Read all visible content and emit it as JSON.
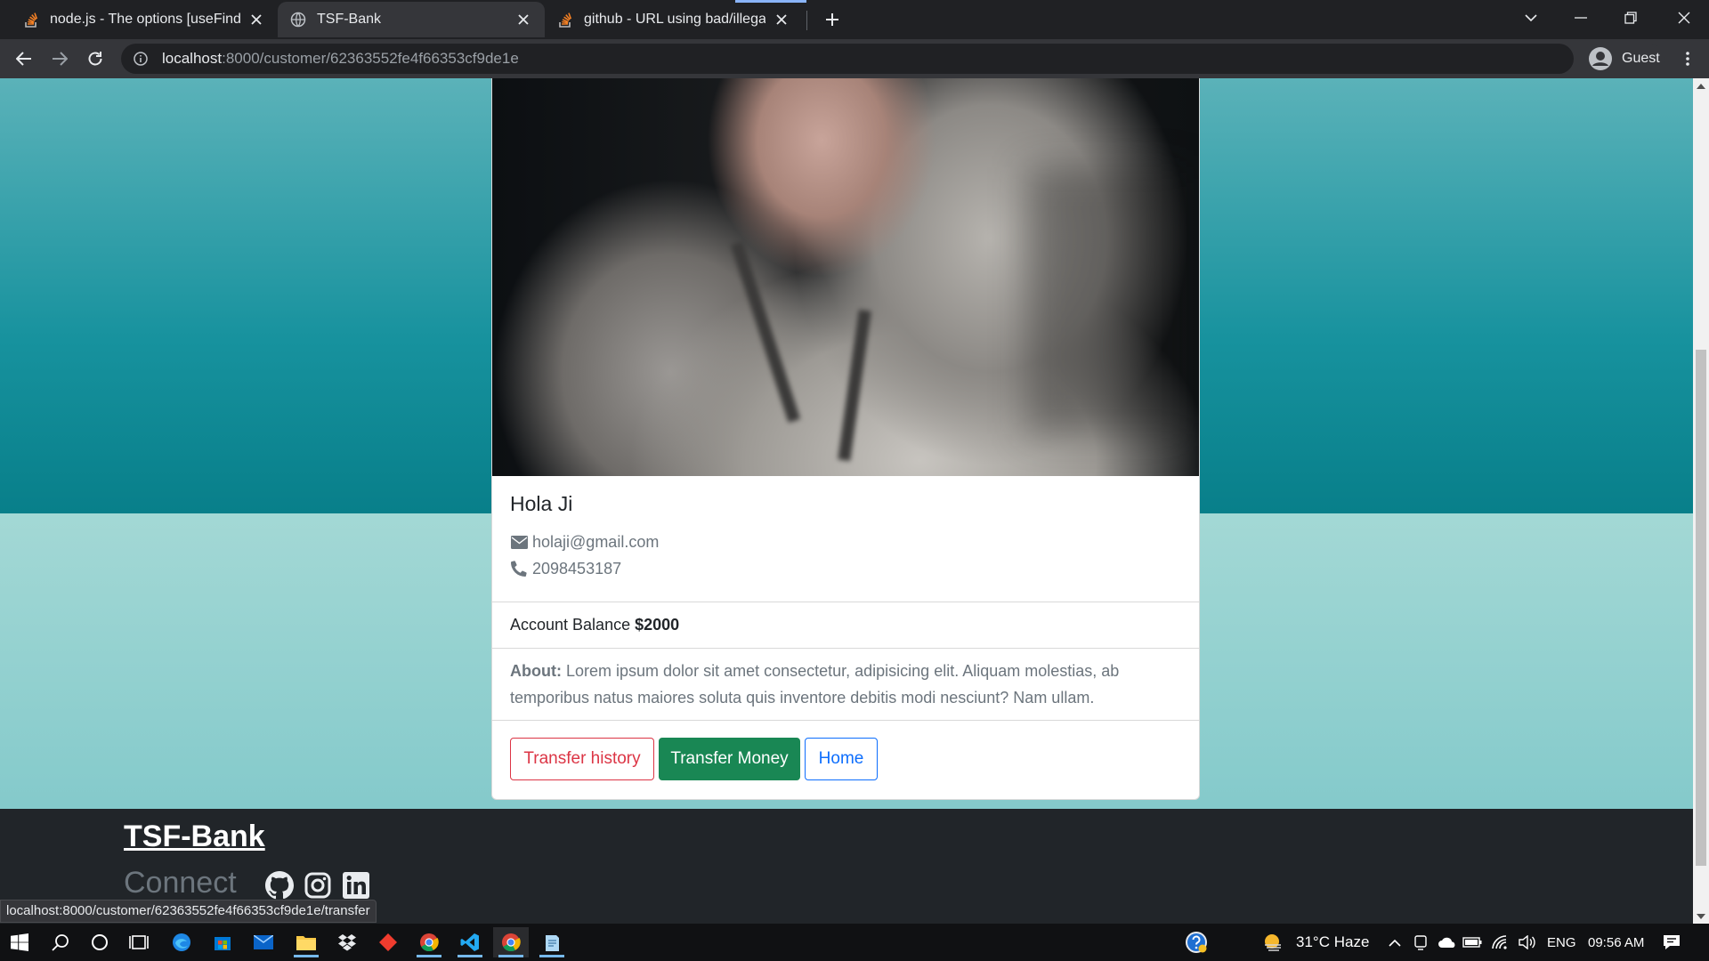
{
  "browser": {
    "tabs": [
      {
        "title": "node.js - The options [useFindAn",
        "favicon": "stackoverflow-icon",
        "active": false
      },
      {
        "title": "TSF-Bank",
        "favicon": "globe-icon",
        "active": true
      },
      {
        "title": "github - URL using bad/illegal fo",
        "favicon": "stackoverflow-icon",
        "active": false
      }
    ],
    "url_host": "localhost",
    "url_path": ":8000/customer/62363552fe4f66353cf9de1e",
    "profile_label": "Guest",
    "status_url": "localhost:8000/customer/62363552fe4f66353cf9de1e/transfer"
  },
  "customer": {
    "name": "Hola Ji",
    "email": "holaji@gmail.com",
    "phone": "2098453187",
    "balance_label": "Account Balance",
    "balance_value": "$2000",
    "about_label": "About:",
    "about_text": "Lorem ipsum dolor sit amet consectetur, adipisicing elit. Aliquam molestias, ab temporibus natus maiores soluta quis inventore debitis modi nesciunt? Nam ullam."
  },
  "actions": {
    "history": "Transfer history",
    "transfer": "Transfer Money",
    "home": "Home"
  },
  "footer": {
    "brand": "TSF-Bank",
    "connect": "Connect",
    "social_icons": [
      "github-icon",
      "instagram-icon",
      "linkedin-icon"
    ]
  },
  "taskbar": {
    "weather": "31°C  Haze",
    "language": "ENG",
    "time": "09:56 AM"
  },
  "colors": {
    "history_btn": "#dc3545",
    "transfer_btn": "#198754",
    "home_btn": "#0d6efd",
    "hero_teal": "#17929e",
    "footer_bg": "#212529"
  }
}
